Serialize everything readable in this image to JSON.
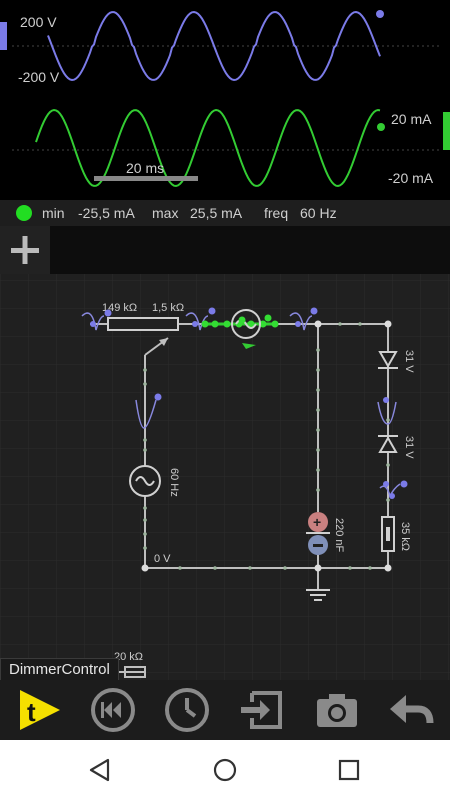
{
  "scope": {
    "voltage_top_label": "200 V",
    "voltage_bottom_label": "-200 V",
    "current_top_label": "20 mA",
    "current_bottom_label": "-20 mA",
    "time_scale_label": "20 ms",
    "voltage_color": "#7b7be8",
    "current_color": "#33cc33"
  },
  "scope_info": {
    "min_label": "min",
    "min_value": "-25,5 mA",
    "max_label": "max",
    "max_value": "25,5 mA",
    "freq_label": "freq",
    "freq_value": "60 Hz"
  },
  "add_button": {
    "icon": "plus-icon"
  },
  "circuit": {
    "resistor1_label": "149 kΩ",
    "resistor2_label": "1,5 kΩ",
    "source_label": "60 Hz",
    "ground_label": "0 V",
    "diode1_label": "31 V",
    "diode2_label": "31 V",
    "capacitor_label": "220 nF",
    "resistor3_label": "35 kΩ",
    "offscreen_label": "20 kΩ"
  },
  "controller_label": "DimmerControl",
  "toolbar": {
    "items": [
      "run-icon",
      "rewind-icon",
      "clock-icon",
      "import-icon",
      "camera-icon",
      "undo-icon"
    ]
  },
  "navbar": {
    "items": [
      "back-icon",
      "home-icon",
      "recents-icon"
    ]
  }
}
